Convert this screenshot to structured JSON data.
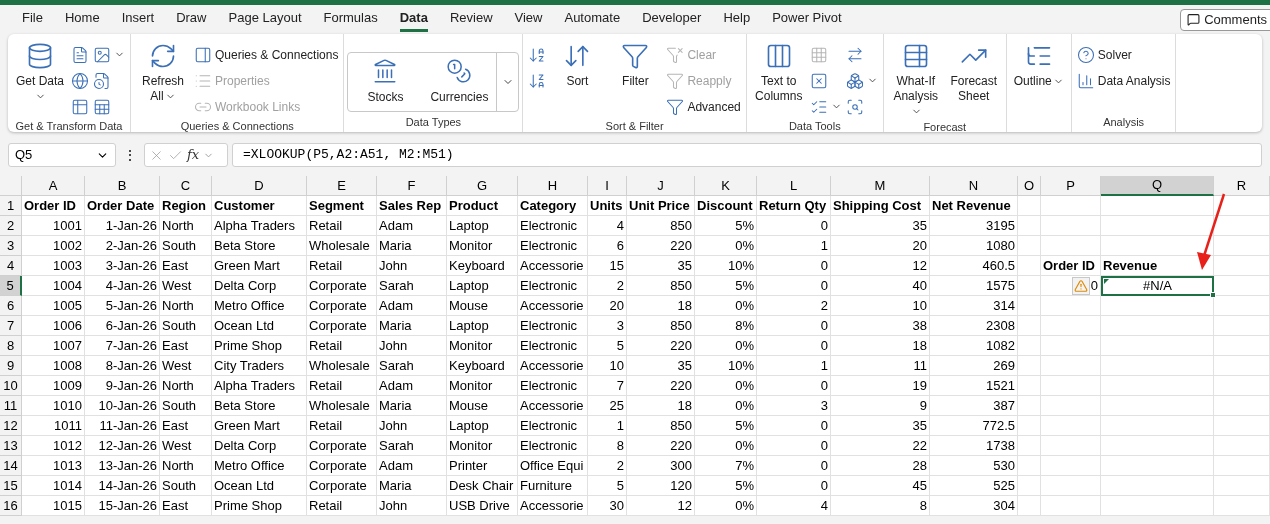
{
  "menu_tabs": [
    {
      "label": "File",
      "selected": false
    },
    {
      "label": "Home",
      "selected": false
    },
    {
      "label": "Insert",
      "selected": false
    },
    {
      "label": "Draw",
      "selected": false
    },
    {
      "label": "Page Layout",
      "selected": false
    },
    {
      "label": "Formulas",
      "selected": false
    },
    {
      "label": "Data",
      "selected": true
    },
    {
      "label": "Review",
      "selected": false
    },
    {
      "label": "View",
      "selected": false
    },
    {
      "label": "Automate",
      "selected": false
    },
    {
      "label": "Developer",
      "selected": false
    },
    {
      "label": "Help",
      "selected": false
    },
    {
      "label": "Power Pivot",
      "selected": false
    }
  ],
  "comments_button": "Comments",
  "ribbon": {
    "groups": [
      {
        "label": "Get & Transform Data",
        "items": [
          {
            "kind": "large",
            "label": "Get Data",
            "dropdown": true,
            "disabled": false
          },
          {
            "kind": "stack",
            "items": [
              {
                "dropdown": false,
                "disabled": false
              },
              {
                "dropdown": false,
                "disabled": false
              },
              {
                "dropdown": false,
                "disabled": false
              }
            ]
          },
          {
            "kind": "stack",
            "items": [
              {
                "dropdown": true,
                "disabled": false
              },
              {
                "dropdown": false,
                "disabled": false
              },
              {
                "dropdown": false,
                "disabled": false
              }
            ]
          }
        ]
      },
      {
        "label": "Queries & Connections",
        "items": [
          {
            "kind": "large",
            "label": "Refresh All",
            "dropdown": true,
            "disabled": false
          },
          {
            "kind": "stack",
            "items": [
              {
                "label": "Queries & Connections",
                "dropdown": false,
                "disabled": false
              },
              {
                "label": "Properties",
                "dropdown": false,
                "disabled": true
              },
              {
                "label": "Workbook Links",
                "dropdown": false,
                "disabled": true
              }
            ]
          }
        ]
      },
      {
        "label": "Data Types",
        "items": [
          {
            "kind": "gallery",
            "items": [
              {
                "label": "Stocks"
              },
              {
                "label": "Currencies"
              }
            ]
          }
        ]
      },
      {
        "label": "Sort & Filter",
        "items": [
          {
            "kind": "stack",
            "items": [
              {
                "dropdown": false,
                "disabled": false
              },
              {
                "dropdown": false,
                "disabled": false
              }
            ]
          },
          {
            "kind": "large",
            "label": "Sort",
            "dropdown": false,
            "disabled": false
          },
          {
            "kind": "large",
            "label": "Filter",
            "dropdown": false,
            "disabled": false
          },
          {
            "kind": "stack",
            "items": [
              {
                "label": "Clear",
                "dropdown": false,
                "disabled": true
              },
              {
                "label": "Reapply",
                "dropdown": false,
                "disabled": true
              },
              {
                "label": "Advanced",
                "dropdown": false,
                "disabled": false
              }
            ]
          }
        ]
      },
      {
        "label": "Data Tools",
        "items": [
          {
            "kind": "large",
            "label": "Text to Columns",
            "dropdown": false,
            "disabled": false
          },
          {
            "kind": "stack",
            "items": [
              {
                "dropdown": false,
                "disabled": true
              },
              {
                "dropdown": false,
                "disabled": false
              },
              {
                "dropdown": true,
                "disabled": false
              }
            ]
          },
          {
            "kind": "stack",
            "items": [
              {
                "dropdown": false,
                "disabled": false
              },
              {
                "dropdown": true,
                "disabled": false
              },
              {
                "dropdown": false,
                "disabled": false
              }
            ]
          }
        ]
      },
      {
        "label": "Forecast",
        "items": [
          {
            "kind": "large",
            "label": "What-If Analysis",
            "dropdown": true,
            "disabled": false
          },
          {
            "kind": "large",
            "label": "Forecast Sheet",
            "dropdown": false,
            "disabled": false
          }
        ]
      },
      {
        "items": [
          {
            "kind": "large",
            "label": "Outline",
            "dropdown": true,
            "disabled": false
          }
        ]
      },
      {
        "label": "Analysis",
        "items": [
          {
            "kind": "stack",
            "items": [
              {
                "label": "Solver",
                "dropdown": false,
                "disabled": false
              },
              {
                "label": "Data Analysis",
                "dropdown": false,
                "disabled": false
              }
            ]
          }
        ]
      }
    ]
  },
  "formula_bar": {
    "name_box": "Q5",
    "more": "⋮",
    "fx": "fx",
    "formula": "=XLOOKUP(P5,A2:A51, M2:M51)"
  },
  "column_letters": [
    {
      "label": "A",
      "selected": false
    },
    {
      "label": "B",
      "selected": false
    },
    {
      "label": "C",
      "selected": false
    },
    {
      "label": "D",
      "selected": false
    },
    {
      "label": "E",
      "selected": false
    },
    {
      "label": "F",
      "selected": false
    },
    {
      "label": "G",
      "selected": false
    },
    {
      "label": "H",
      "selected": false
    },
    {
      "label": "I",
      "selected": false
    },
    {
      "label": "J",
      "selected": false
    },
    {
      "label": "K",
      "selected": false
    },
    {
      "label": "L",
      "selected": false
    },
    {
      "label": "M",
      "selected": false
    },
    {
      "label": "N",
      "selected": false
    },
    {
      "label": "O",
      "selected": false
    },
    {
      "label": "P",
      "selected": false
    },
    {
      "label": "Q",
      "selected": true
    },
    {
      "label": "R",
      "selected": false
    }
  ],
  "row_numbers": [
    {
      "label": "1",
      "selected": false
    },
    {
      "label": "2",
      "selected": false
    },
    {
      "label": "3",
      "selected": false
    },
    {
      "label": "4",
      "selected": false
    },
    {
      "label": "5",
      "selected": true
    },
    {
      "label": "6",
      "selected": false
    },
    {
      "label": "7",
      "selected": false
    },
    {
      "label": "8",
      "selected": false
    },
    {
      "label": "9",
      "selected": false
    },
    {
      "label": "10",
      "selected": false
    },
    {
      "label": "11",
      "selected": false
    },
    {
      "label": "12",
      "selected": false
    },
    {
      "label": "13",
      "selected": false
    },
    {
      "label": "14",
      "selected": false
    },
    {
      "label": "15",
      "selected": false
    },
    {
      "label": "16",
      "selected": false
    }
  ],
  "table": {
    "fields": [
      {
        "header": "Order ID",
        "kind": "number"
      },
      {
        "header": "Order Date",
        "kind": "number"
      },
      {
        "header": "Region",
        "kind": "text"
      },
      {
        "header": "Customer",
        "kind": "text"
      },
      {
        "header": "Segment",
        "kind": "text"
      },
      {
        "header": "Sales Rep",
        "kind": "text"
      },
      {
        "header": "Product",
        "kind": "text"
      },
      {
        "header": "Category",
        "kind": "text"
      },
      {
        "header": "Units",
        "kind": "number"
      },
      {
        "header": "Unit Price",
        "kind": "number"
      },
      {
        "header": "Discount",
        "kind": "number"
      },
      {
        "header": "Return Qty",
        "kind": "number"
      },
      {
        "header": "Shipping Cost",
        "kind": "number"
      },
      {
        "header": "Net Revenue",
        "kind": "number"
      }
    ],
    "rows": [
      [
        "1001",
        "1-Jan-26",
        "North",
        "Alpha Traders",
        "Retail",
        "Adam",
        "Laptop",
        "Electronic",
        "4",
        "850",
        "5%",
        "0",
        "35",
        "3195"
      ],
      [
        "1002",
        "2-Jan-26",
        "South",
        "Beta Store",
        "Wholesale",
        "Maria",
        "Monitor",
        "Electronic",
        "6",
        "220",
        "0%",
        "1",
        "20",
        "1080"
      ],
      [
        "1003",
        "3-Jan-26",
        "East",
        "Green Mart",
        "Retail",
        "John",
        "Keyboard",
        "Accessorie",
        "15",
        "35",
        "10%",
        "0",
        "12",
        "460.5"
      ],
      [
        "1004",
        "4-Jan-26",
        "West",
        "Delta Corp",
        "Corporate",
        "Sarah",
        "Laptop",
        "Electronic",
        "2",
        "850",
        "5%",
        "0",
        "40",
        "1575"
      ],
      [
        "1005",
        "5-Jan-26",
        "North",
        "Metro Office",
        "Corporate",
        "Adam",
        "Mouse",
        "Accessorie",
        "20",
        "18",
        "0%",
        "2",
        "10",
        "314"
      ],
      [
        "1006",
        "6-Jan-26",
        "South",
        "Ocean Ltd",
        "Corporate",
        "Maria",
        "Laptop",
        "Electronic",
        "3",
        "850",
        "8%",
        "0",
        "38",
        "2308"
      ],
      [
        "1007",
        "7-Jan-26",
        "East",
        "Prime Shop",
        "Retail",
        "John",
        "Monitor",
        "Electronic",
        "5",
        "220",
        "0%",
        "0",
        "18",
        "1082"
      ],
      [
        "1008",
        "8-Jan-26",
        "West",
        "City Traders",
        "Wholesale",
        "Sarah",
        "Keyboard",
        "Accessorie",
        "10",
        "35",
        "10%",
        "1",
        "11",
        "269"
      ],
      [
        "1009",
        "9-Jan-26",
        "North",
        "Alpha Traders",
        "Retail",
        "Adam",
        "Monitor",
        "Electronic",
        "7",
        "220",
        "0%",
        "0",
        "19",
        "1521"
      ],
      [
        "1010",
        "10-Jan-26",
        "South",
        "Beta Store",
        "Wholesale",
        "Maria",
        "Mouse",
        "Accessorie",
        "25",
        "18",
        "0%",
        "3",
        "9",
        "387"
      ],
      [
        "1011",
        "11-Jan-26",
        "East",
        "Green Mart",
        "Retail",
        "John",
        "Laptop",
        "Electronic",
        "1",
        "850",
        "5%",
        "0",
        "35",
        "772.5"
      ],
      [
        "1012",
        "12-Jan-26",
        "West",
        "Delta Corp",
        "Corporate",
        "Sarah",
        "Monitor",
        "Electronic",
        "8",
        "220",
        "0%",
        "0",
        "22",
        "1738"
      ],
      [
        "1013",
        "13-Jan-26",
        "North",
        "Metro Office",
        "Corporate",
        "Adam",
        "Printer",
        "Office Equi",
        "2",
        "300",
        "7%",
        "0",
        "28",
        "530"
      ],
      [
        "1014",
        "14-Jan-26",
        "South",
        "Ocean Ltd",
        "Corporate",
        "Maria",
        "Desk Chair",
        "Furniture",
        "5",
        "120",
        "5%",
        "0",
        "45",
        "525"
      ],
      [
        "1015",
        "15-Jan-26",
        "East",
        "Prime Shop",
        "Retail",
        "John",
        "USB Drive",
        "Accessorie",
        "30",
        "12",
        "0%",
        "4",
        "8",
        "304"
      ]
    ]
  },
  "lookup": {
    "headers": [
      "Order ID",
      "Revenue"
    ],
    "order_id": "0",
    "warning": true,
    "result": "#N/A",
    "result_error": true,
    "result_selected": true
  }
}
